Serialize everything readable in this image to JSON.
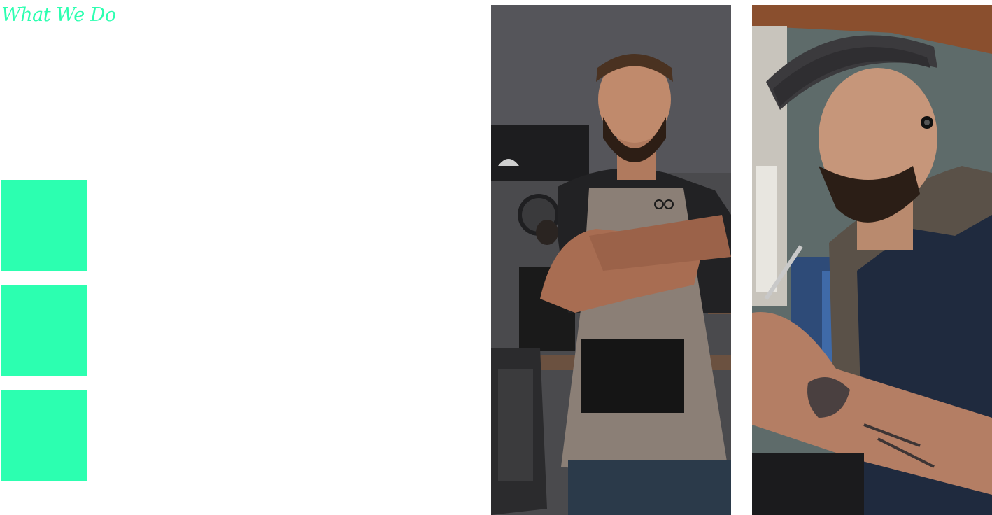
{
  "section": {
    "title": "What We Do"
  },
  "services": [
    {
      "color": "#2cffb0"
    },
    {
      "color": "#2cffb0"
    },
    {
      "color": "#2cffb0"
    }
  ],
  "photos": [
    {
      "icon": "barber-with-apron-photo"
    },
    {
      "icon": "barber-with-cap-and-scissors-photo"
    }
  ],
  "colors": {
    "accent": "#2cffb0"
  }
}
